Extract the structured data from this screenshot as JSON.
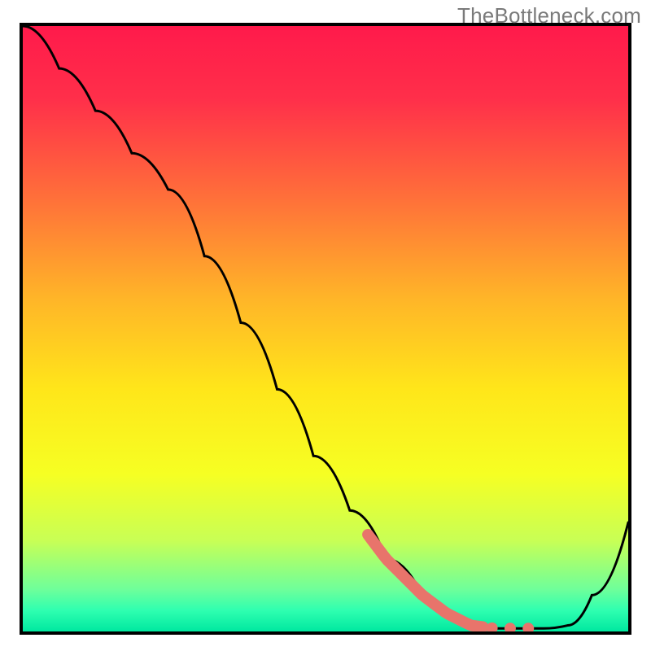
{
  "watermark": "TheBottleneck.com",
  "colors": {
    "frame": "#000000",
    "line": "#000000",
    "highlight": "#e8746b",
    "gradient_stops": [
      {
        "offset": 0.0,
        "color": "#ff1a4b"
      },
      {
        "offset": 0.12,
        "color": "#ff2f4a"
      },
      {
        "offset": 0.28,
        "color": "#ff6e3a"
      },
      {
        "offset": 0.45,
        "color": "#ffb528"
      },
      {
        "offset": 0.6,
        "color": "#ffe61a"
      },
      {
        "offset": 0.74,
        "color": "#f6ff23"
      },
      {
        "offset": 0.85,
        "color": "#c8ff55"
      },
      {
        "offset": 0.93,
        "color": "#6fff9a"
      },
      {
        "offset": 0.965,
        "color": "#2fffb0"
      },
      {
        "offset": 1.0,
        "color": "#00e8a0"
      }
    ]
  },
  "chart_data": {
    "type": "line",
    "title": "",
    "xlabel": "",
    "ylabel": "",
    "xlim": [
      0,
      100
    ],
    "ylim": [
      0,
      100
    ],
    "x": [
      0,
      6,
      12,
      18,
      24,
      30,
      36,
      42,
      48,
      54,
      60,
      66,
      70,
      74,
      78,
      82,
      86,
      90,
      94,
      100
    ],
    "y": [
      100,
      93,
      86,
      79,
      73,
      62,
      51,
      40,
      29,
      20,
      12,
      6,
      3,
      1,
      0.5,
      0.5,
      0.5,
      1,
      6,
      18
    ],
    "highlight_range_x": [
      57,
      76
    ],
    "highlight_dots_x": [
      77.5,
      80.5,
      83.5
    ]
  }
}
